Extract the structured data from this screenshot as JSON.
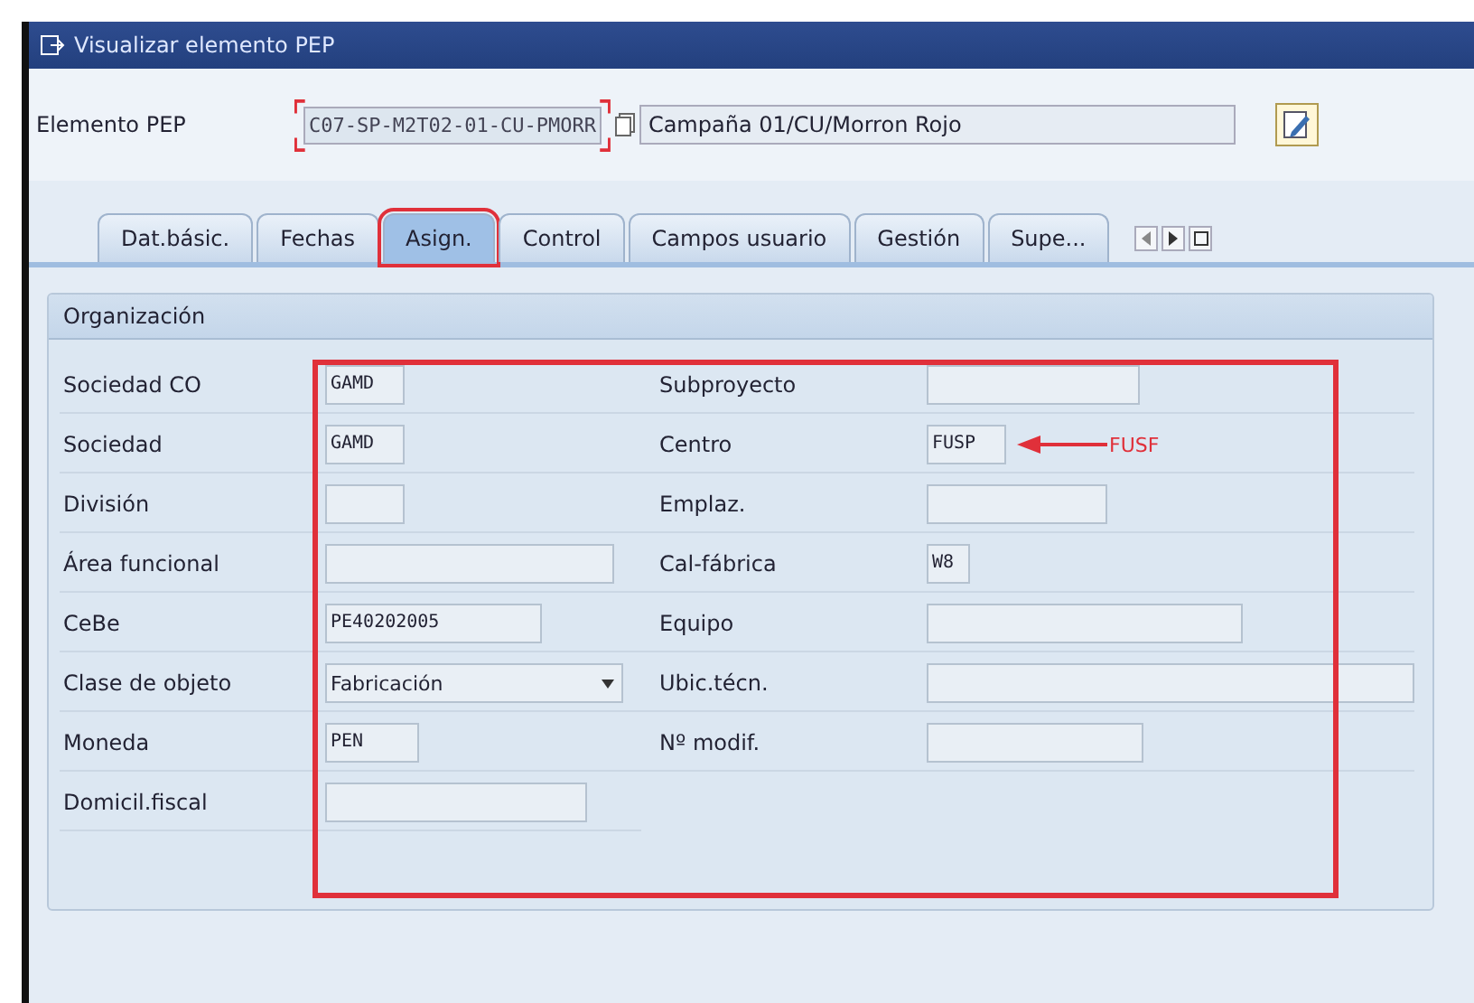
{
  "window": {
    "title": "Visualizar elemento PEP"
  },
  "header": {
    "label": "Elemento PEP",
    "value": "C07-SP-M2T02-01-CU-PMORR",
    "description": "Campaña 01/CU/Morron Rojo"
  },
  "tabs": [
    {
      "label": "Dat.básic.",
      "selected": false
    },
    {
      "label": "Fechas",
      "selected": false
    },
    {
      "label": "Asign.",
      "selected": true
    },
    {
      "label": "Control",
      "selected": false
    },
    {
      "label": "Campos usuario",
      "selected": false
    },
    {
      "label": "Gestión",
      "selected": false
    },
    {
      "label": "Supe...",
      "selected": false
    }
  ],
  "group": {
    "title": "Organización",
    "left_fields": [
      {
        "label": "Sociedad CO",
        "value": "GAMD",
        "kind": "text"
      },
      {
        "label": "Sociedad",
        "value": "GAMD",
        "kind": "text"
      },
      {
        "label": "División",
        "kind": "text"
      },
      {
        "label": "Área funcional",
        "kind": "text"
      },
      {
        "label": "CeBe",
        "value": "PE40202005",
        "kind": "text"
      },
      {
        "label": "Clase de objeto",
        "value": "Fabricación",
        "kind": "dropdown"
      },
      {
        "label": "Moneda",
        "value": "PEN",
        "kind": "text"
      },
      {
        "label": "Domicil.fiscal",
        "kind": "text"
      }
    ],
    "right_fields": [
      {
        "label": "Subproyecto",
        "kind": "text"
      },
      {
        "label": "Centro",
        "value": "FUSP",
        "kind": "text"
      },
      {
        "label": "Emplaz.",
        "kind": "text"
      },
      {
        "label": "Cal-fábrica",
        "value": "W8",
        "kind": "text"
      },
      {
        "label": "Equipo",
        "kind": "text"
      },
      {
        "label": "Ubic.técn.",
        "kind": "text"
      },
      {
        "label": "Nº modif.",
        "kind": "text"
      }
    ]
  },
  "annotation": {
    "text": "FUSF"
  }
}
